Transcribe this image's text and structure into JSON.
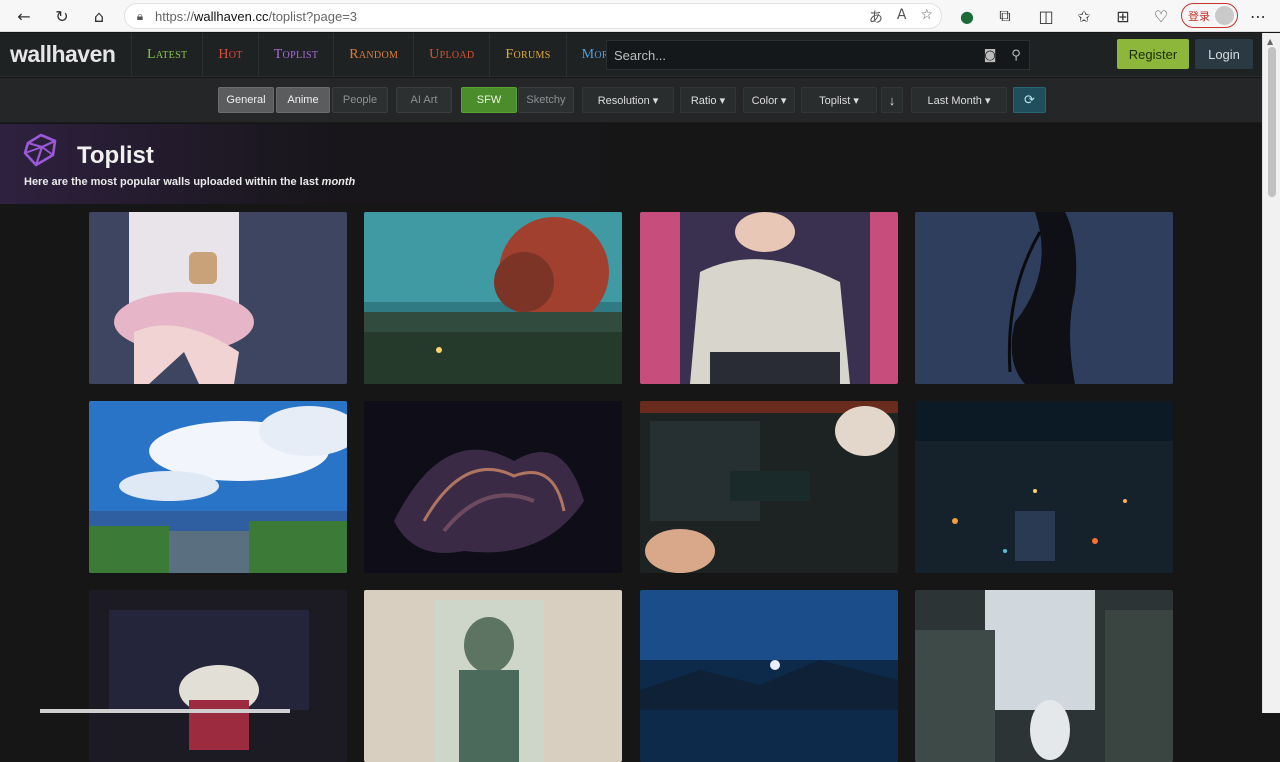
{
  "browser": {
    "url_prefix": "https://",
    "url_domain": "wallhaven.cc",
    "url_path": "/toplist?page=3",
    "login_label": "登录"
  },
  "header": {
    "logo": "wallhaven",
    "nav": [
      {
        "label": "Latest",
        "color": "#8bc34a"
      },
      {
        "label": "Hot",
        "color": "#e04a3b"
      },
      {
        "label": "Toplist",
        "color": "#a66bd9"
      },
      {
        "label": "Random",
        "color": "#e07b38"
      },
      {
        "label": "Upload",
        "color": "#d9532b"
      },
      {
        "label": "Forums",
        "color": "#e0a83a"
      },
      {
        "label": "More",
        "color": "#4a9fe0"
      }
    ],
    "search_placeholder": "Search...",
    "register_label": "Register",
    "login_label": "Login"
  },
  "filters": {
    "general": "General",
    "anime": "Anime",
    "people": "People",
    "ai_art": "AI Art",
    "sfw": "SFW",
    "sketchy": "Sketchy",
    "resolution": "Resolution ▾",
    "ratio": "Ratio ▾",
    "color": "Color ▾",
    "sort": "Toplist ▾",
    "order_icon": "↓",
    "range": "Last Month ▾",
    "refresh_icon": "⟳"
  },
  "page": {
    "title": "Toplist",
    "subtitle_prefix": "Here are the most popular walls uploaded within the last ",
    "subtitle_em": "month"
  }
}
